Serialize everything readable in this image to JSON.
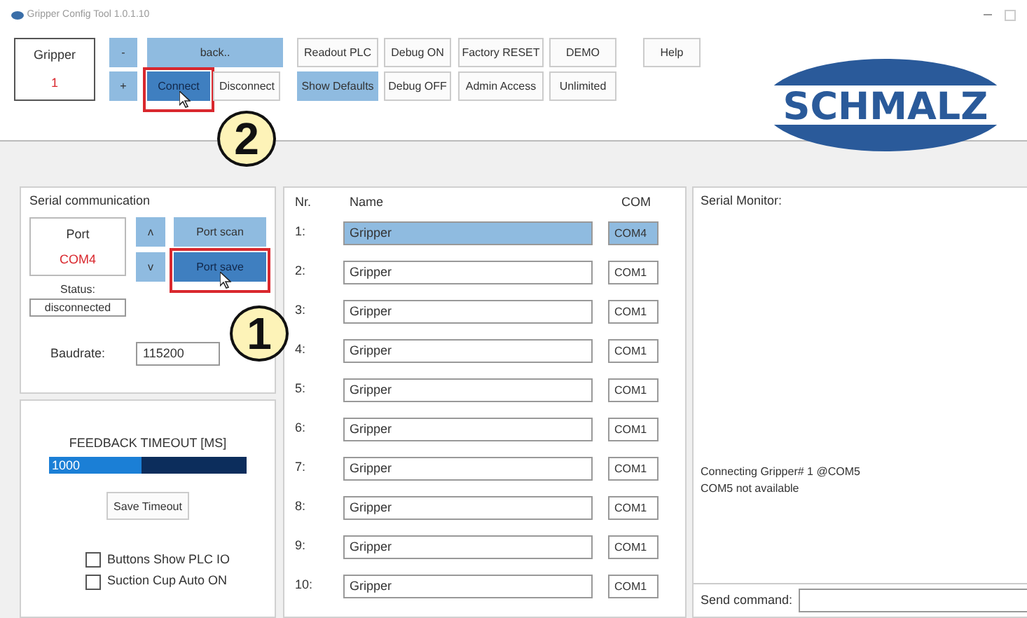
{
  "window": {
    "title": "Gripper Config Tool 1.0.1.10"
  },
  "gripper_selector": {
    "label": "Gripper",
    "value": "1"
  },
  "toolbar": {
    "columns": [
      {
        "buttons": [
          {
            "label": "-",
            "kind": "blue"
          },
          {
            "label": "+",
            "kind": "blue"
          }
        ]
      },
      {
        "buttons": [
          {
            "label": "back..",
            "kind": "blue"
          },
          {
            "label": "Connect",
            "kind": "pressed",
            "hovered": true,
            "callout": "2"
          },
          {
            "label": "Disconnect",
            "kind": "plain"
          }
        ]
      },
      {
        "buttons": [
          {
            "label": "Readout PLC",
            "kind": "plain"
          },
          {
            "label": "Show Defaults",
            "kind": "blue"
          }
        ]
      },
      {
        "buttons": [
          {
            "label": "Debug ON",
            "kind": "plain"
          },
          {
            "label": "Debug OFF",
            "kind": "plain"
          }
        ]
      },
      {
        "buttons": [
          {
            "label": "Factory RESET",
            "kind": "plain"
          },
          {
            "label": "Admin Access",
            "kind": "plain"
          }
        ]
      },
      {
        "buttons": [
          {
            "label": "DEMO",
            "kind": "plain"
          },
          {
            "label": "Unlimited",
            "kind": "plain"
          }
        ]
      },
      {
        "buttons": [
          {
            "label": "Help",
            "kind": "plain"
          }
        ]
      }
    ]
  },
  "logo": {
    "text": "SCHMALZ"
  },
  "serial": {
    "title": "Serial communication",
    "port": {
      "label": "Port",
      "value": "COM4"
    },
    "buttons": [
      {
        "label": "ʌ",
        "kind": "blue"
      },
      {
        "label": "Port scan",
        "kind": "blue"
      },
      {
        "label": "v",
        "kind": "blue"
      },
      {
        "label": "Port save",
        "kind": "pressed",
        "hovered": true,
        "callout": "1"
      }
    ],
    "status": {
      "label": "Status:",
      "value": "disconnected"
    },
    "baudrate": {
      "label": "Baudrate:",
      "value": "115200"
    }
  },
  "timeout": {
    "title": "FEEDBACK TIMEOUT [MS]",
    "value": "1000",
    "level": 0.47,
    "button": "Save Timeout",
    "checkboxes": [
      {
        "label": "Buttons Show PLC IO",
        "checked": false
      },
      {
        "label": "Suction Cup Auto ON",
        "checked": false
      }
    ]
  },
  "grippers": {
    "columns": [
      "Nr.",
      "Name",
      "COM"
    ],
    "rows": [
      {
        "nr": "1:",
        "name": "Gripper",
        "com": "COM4",
        "selected": true
      },
      {
        "nr": "2:",
        "name": "Gripper",
        "com": "COM1",
        "selected": false
      },
      {
        "nr": "3:",
        "name": "Gripper",
        "com": "COM1",
        "selected": false
      },
      {
        "nr": "4:",
        "name": "Gripper",
        "com": "COM1",
        "selected": false
      },
      {
        "nr": "5:",
        "name": "Gripper",
        "com": "COM1",
        "selected": false
      },
      {
        "nr": "6:",
        "name": "Gripper",
        "com": "COM1",
        "selected": false
      },
      {
        "nr": "7:",
        "name": "Gripper",
        "com": "COM1",
        "selected": false
      },
      {
        "nr": "8:",
        "name": "Gripper",
        "com": "COM1",
        "selected": false
      },
      {
        "nr": "9:",
        "name": "Gripper",
        "com": "COM1",
        "selected": false
      },
      {
        "nr": "10:",
        "name": "Gripper",
        "com": "COM1",
        "selected": false
      }
    ]
  },
  "monitor": {
    "title": "Serial Monitor:",
    "lines": [
      "Connecting Gripper# 1 @COM5",
      "COM5 not available"
    ],
    "send_label": "Send command:"
  }
}
